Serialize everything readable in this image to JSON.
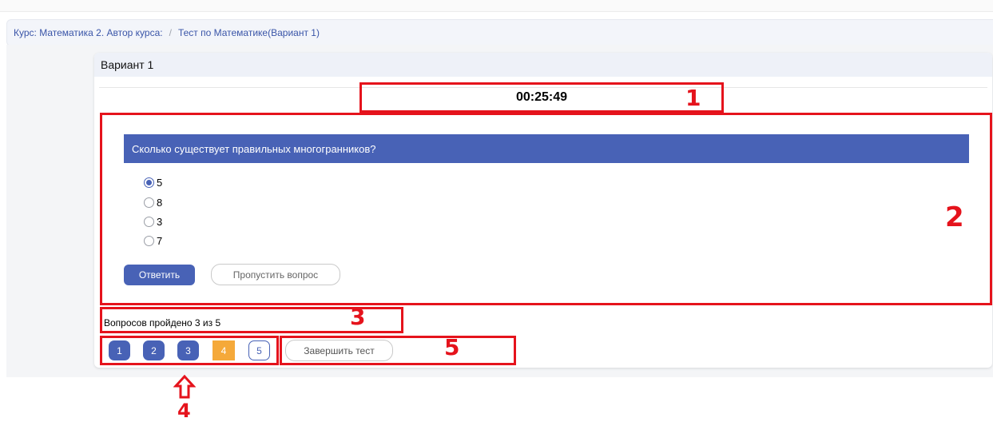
{
  "breadcrumb": {
    "course": "Курс: Математика 2. Автор курса:",
    "separator": "/",
    "current": "Тест по Математике(Вариант 1)"
  },
  "card": {
    "title": "Вариант 1"
  },
  "timer": {
    "value": "00:25:49"
  },
  "question": {
    "text": "Сколько существует правильных многогранников?",
    "options": [
      {
        "label": "5",
        "selected": true
      },
      {
        "label": "8",
        "selected": false
      },
      {
        "label": "3",
        "selected": false
      },
      {
        "label": "7",
        "selected": false
      }
    ],
    "answer_label": "Ответить",
    "skip_label": "Пропустить вопрос"
  },
  "progress": {
    "text": "Вопросов пройдено 3 из 5"
  },
  "navigator": {
    "items": [
      {
        "label": "1",
        "state": "done"
      },
      {
        "label": "2",
        "state": "done"
      },
      {
        "label": "3",
        "state": "done"
      },
      {
        "label": "4",
        "state": "current"
      },
      {
        "label": "5",
        "state": "open"
      }
    ]
  },
  "finish_label": "Завершить тест",
  "annotations": {
    "a1": "1",
    "a2": "2",
    "a3": "3",
    "a4": "4",
    "a5": "5"
  },
  "colors": {
    "primary": "#4862b6",
    "current": "#f5a93a",
    "annotation": "#e5131c"
  }
}
